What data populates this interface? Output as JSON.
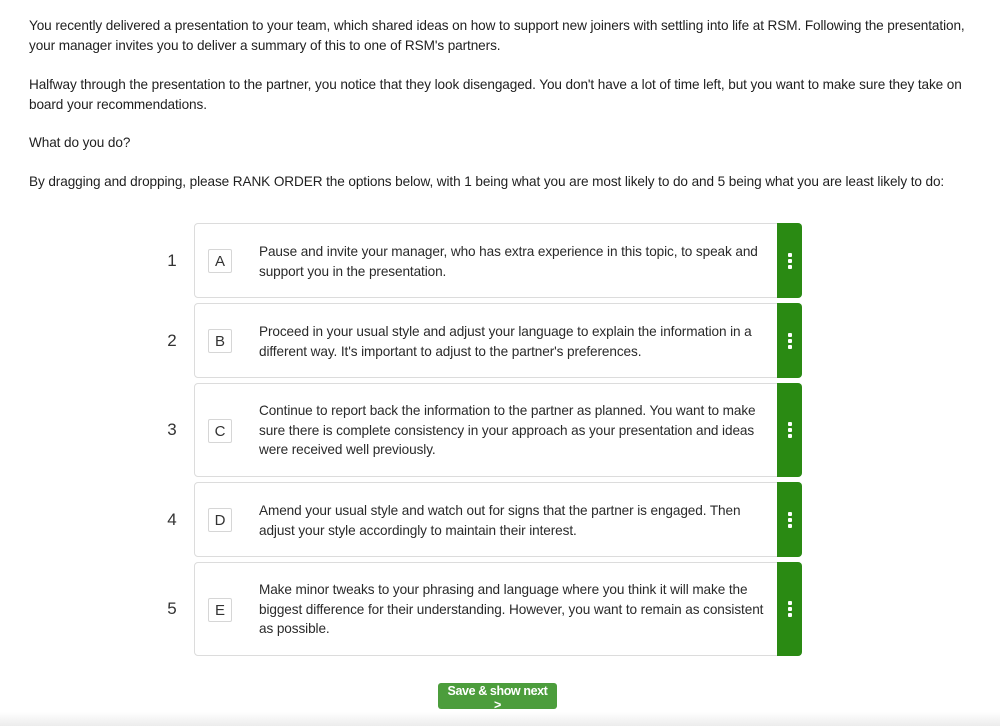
{
  "intro": {
    "paragraph_1": "You recently delivered a presentation to your team, which shared ideas on how to support new joiners with settling into life at RSM. Following the presentation, your manager invites you to deliver a summary of this to one of RSM's partners.",
    "paragraph_2": "Halfway through the presentation to the partner, you notice that they look disengaged. You don't have a lot of time left, but you want to make sure they take on board your recommendations.",
    "question": "What do you do?",
    "instruction": "By dragging and dropping, please RANK ORDER the options below, with 1 being what you are most likely to do and 5 being what you are least likely to do:"
  },
  "ranking": {
    "items": [
      {
        "rank": "1",
        "letter": "A",
        "text": "Pause and invite your manager, who has extra experience in this topic, to speak and support you in the presentation.",
        "handle_icon": "drag-handle-icon"
      },
      {
        "rank": "2",
        "letter": "B",
        "text": "Proceed in your usual style and adjust your language to explain the information in a different way. It's important to adjust to the partner's preferences.",
        "handle_icon": "drag-handle-icon"
      },
      {
        "rank": "3",
        "letter": "C",
        "text": "Continue to report back the information to the partner as planned. You want to make sure there is complete consistency in your approach as your presentation and ideas were received well previously.",
        "handle_icon": "drag-handle-icon"
      },
      {
        "rank": "4",
        "letter": "D",
        "text": "Amend your usual style and watch out for signs that the partner is engaged. Then adjust your style accordingly to maintain their interest.",
        "handle_icon": "drag-handle-icon"
      },
      {
        "rank": "5",
        "letter": "E",
        "text": "Make minor tweaks to your phrasing and language where you think it will make the biggest difference for their understanding. However, you want to remain as consistent as possible.",
        "handle_icon": "drag-handle-icon"
      }
    ]
  },
  "actions": {
    "save_label": "Save & show next >"
  },
  "colors": {
    "handle_green": "#2a8a13",
    "button_green": "#4c9d3c"
  }
}
